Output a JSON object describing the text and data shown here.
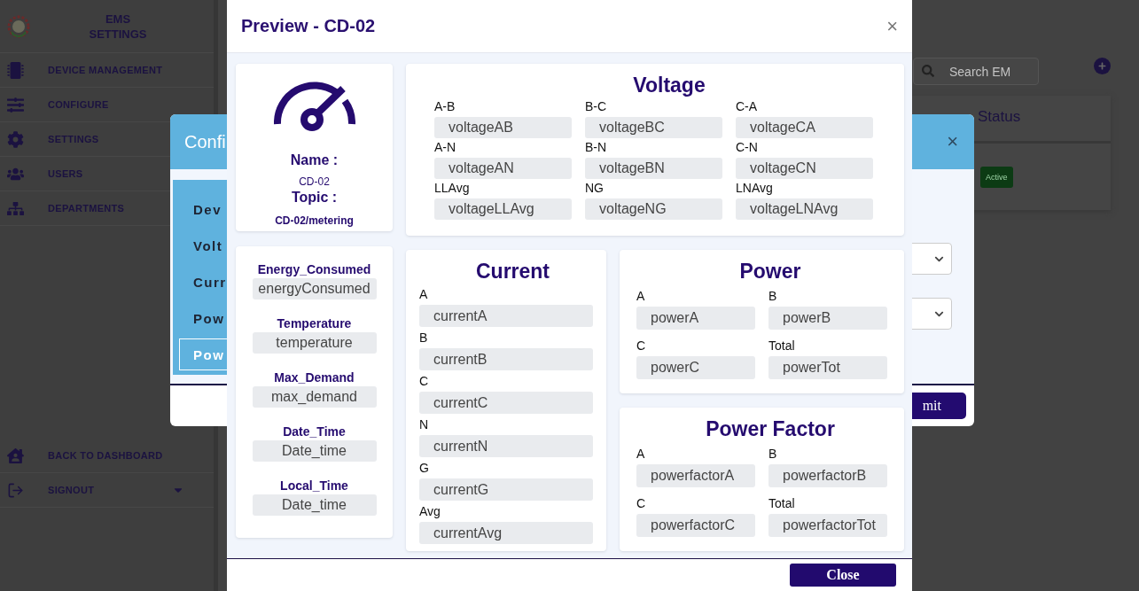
{
  "sidebar": {
    "title": "EMS SETTINGS",
    "items": [
      {
        "label": "DEVICE MANAGEMENT"
      },
      {
        "label": "CONFIGURE"
      },
      {
        "label": "SETTINGS"
      },
      {
        "label": "USERS"
      },
      {
        "label": "DEPARTMENTS"
      }
    ],
    "footer_items": [
      {
        "label": "BACK TO DASHBOARD",
        "caret": false
      },
      {
        "label": "SIGNOUT",
        "caret": true
      }
    ]
  },
  "search": {
    "placeholder": "Search EM"
  },
  "table": {
    "columns": [
      "Status"
    ],
    "rows": [
      {
        "status": "Active"
      }
    ]
  },
  "config_dialog": {
    "title": "Confi",
    "close_label": "×",
    "tabs": [
      {
        "label": "Dev",
        "selected": false
      },
      {
        "label": "Volt",
        "selected": false
      },
      {
        "label": "Curr",
        "selected": false
      },
      {
        "label": "Pow",
        "selected": false
      },
      {
        "label": "Pow",
        "selected": true
      }
    ],
    "submit": "mit"
  },
  "preview": {
    "title": "Preview - CD-02",
    "close_label": "×",
    "device": {
      "name_label": "Name :",
      "name": "CD-02",
      "topic_label": "Topic :",
      "topic": "CD-02/metering"
    },
    "extras": [
      {
        "label": "Energy_Consumed",
        "value": "energyConsumed"
      },
      {
        "label": "Temperature",
        "value": "temperature"
      },
      {
        "label": "Max_Demand",
        "value": "max_demand"
      },
      {
        "label": "Date_Time",
        "value": "Date_time"
      },
      {
        "label": "Local_Time",
        "value": "Date_time"
      }
    ],
    "sections": [
      {
        "title": "Voltage",
        "fields": [
          {
            "label": "A-B",
            "value": "voltageAB"
          },
          {
            "label": "B-C",
            "value": "voltageBC"
          },
          {
            "label": "C-A",
            "value": "voltageCA"
          },
          {
            "label": "A-N",
            "value": "voltageAN"
          },
          {
            "label": "B-N",
            "value": "voltageBN"
          },
          {
            "label": "C-N",
            "value": "voltageCN"
          },
          {
            "label": "LLAvg",
            "value": "voltageLLAvg"
          },
          {
            "label": "NG",
            "value": "voltageNG"
          },
          {
            "label": "LNAvg",
            "value": "voltageLNAvg"
          }
        ]
      },
      {
        "title": "Current",
        "fields": [
          {
            "label": "A",
            "value": "currentA"
          },
          {
            "label": "B",
            "value": "currentB"
          },
          {
            "label": "C",
            "value": "currentC"
          },
          {
            "label": "N",
            "value": "currentN"
          },
          {
            "label": "G",
            "value": "currentG"
          },
          {
            "label": "Avg",
            "value": "currentAvg"
          }
        ]
      },
      {
        "title": "Power",
        "fields": [
          {
            "label": "A",
            "value": "powerA"
          },
          {
            "label": "B",
            "value": "powerB"
          },
          {
            "label": "C",
            "value": "powerC"
          },
          {
            "label": "Total",
            "value": "powerTot"
          }
        ]
      },
      {
        "title": "Power Factor",
        "fields": [
          {
            "label": "A",
            "value": "powerfactorA"
          },
          {
            "label": "B",
            "value": "powerfactorB"
          },
          {
            "label": "C",
            "value": "powerfactorC"
          },
          {
            "label": "Total",
            "value": "powerfactorTot"
          }
        ]
      }
    ],
    "close": "Close"
  }
}
